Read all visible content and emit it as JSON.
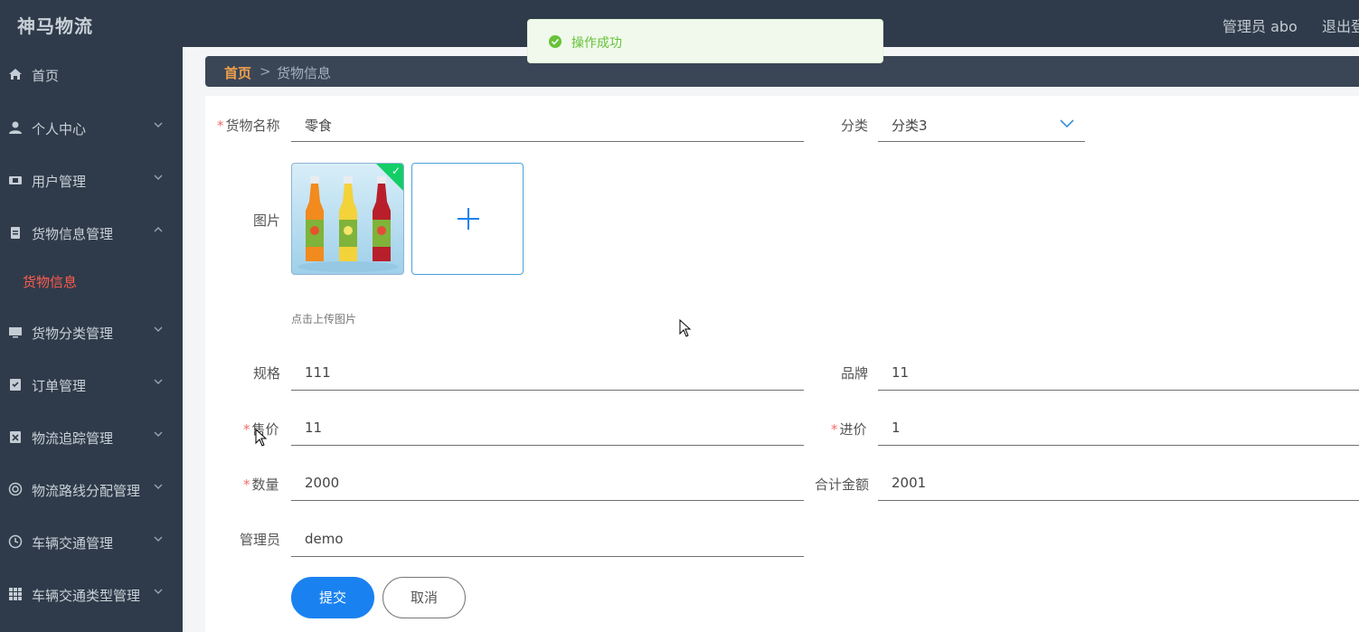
{
  "app": {
    "title": "神马物流"
  },
  "header": {
    "admin_label": "管理员 abo",
    "logout_label": "退出登录"
  },
  "sidebar": {
    "items": [
      {
        "label": "首页",
        "icon": "home-icon"
      },
      {
        "label": "个人中心",
        "icon": "user-icon"
      },
      {
        "label": "用户管理",
        "icon": "users-icon"
      },
      {
        "label": "货物信息管理",
        "icon": "clipboard-icon",
        "expanded": true
      },
      {
        "label": "货物分类管理",
        "icon": "monitor-icon"
      },
      {
        "label": "订单管理",
        "icon": "order-icon"
      },
      {
        "label": "物流追踪管理",
        "icon": "track-icon"
      },
      {
        "label": "物流路线分配管理",
        "icon": "route-icon"
      },
      {
        "label": "车辆交通管理",
        "icon": "clock-icon"
      },
      {
        "label": "车辆交通类型管理",
        "icon": "grid-icon"
      }
    ],
    "active_sub": "货物信息"
  },
  "breadcrumb": {
    "home": "首页",
    "separator": ">",
    "current": "货物信息"
  },
  "toast": {
    "message": "操作成功"
  },
  "form": {
    "name": {
      "label": "货物名称",
      "value": "零食",
      "required": true
    },
    "category": {
      "label": "分类",
      "value": "分类3"
    },
    "image": {
      "label": "图片",
      "hint": "点击上传图片"
    },
    "spec": {
      "label": "规格",
      "value": "111"
    },
    "brand": {
      "label": "品牌",
      "value": "11"
    },
    "price": {
      "label": "售价",
      "value": "11",
      "required": true
    },
    "cost": {
      "label": "进价",
      "value": "1",
      "required": true
    },
    "quantity": {
      "label": "数量",
      "value": "2000",
      "required": true
    },
    "total": {
      "label": "合计金额",
      "value": "2001"
    },
    "manager": {
      "label": "管理员",
      "value": "demo"
    },
    "submit_label": "提交",
    "cancel_label": "取消"
  },
  "colors": {
    "header_bg": "#2f3b4a",
    "accent": "#1a82f0",
    "active_menu": "#ff5b4f",
    "breadcrumb_home": "#f0a04b",
    "success": "#67c23a"
  }
}
